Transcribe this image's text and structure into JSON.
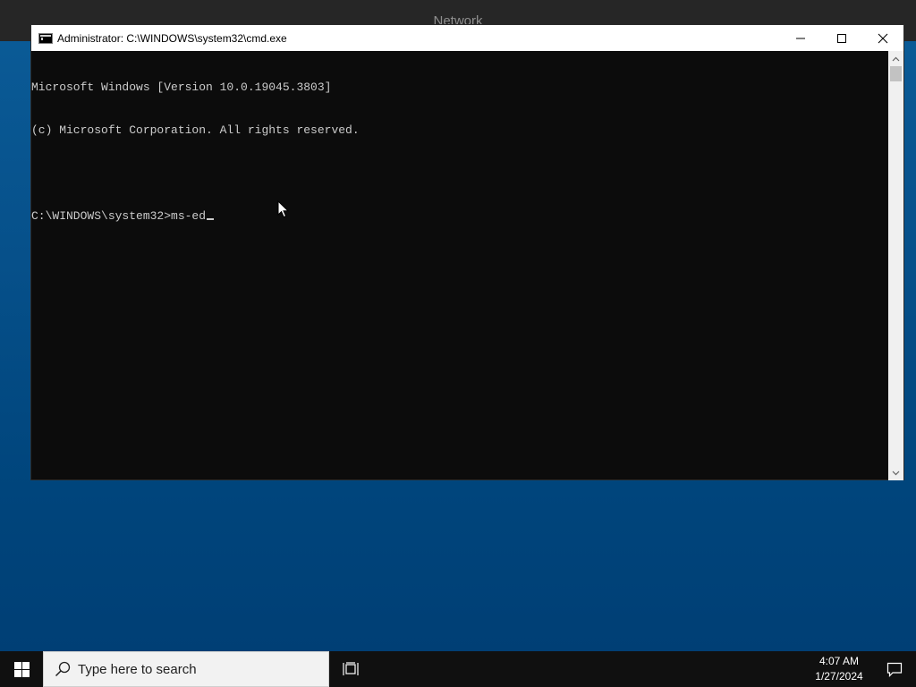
{
  "background_window": {
    "title": "Network"
  },
  "cmd": {
    "title": "Administrator: C:\\WINDOWS\\system32\\cmd.exe",
    "icon": "cmd-icon",
    "controls": {
      "minimize": "minimize-icon",
      "maximize": "maximize-icon",
      "close": "close-icon"
    },
    "lines": [
      "Microsoft Windows [Version 10.0.19045.3803]",
      "(c) Microsoft Corporation. All rights reserved.",
      "",
      "C:\\WINDOWS\\system32>ms-ed"
    ]
  },
  "taskbar": {
    "search_placeholder": "Type here to search",
    "time": "4:07 AM",
    "date": "1/27/2024"
  },
  "colors": {
    "console_bg": "#0c0c0c",
    "console_text": "#cccccc",
    "taskbar_bg": "#101010",
    "desktop_blue": "#00457c"
  }
}
